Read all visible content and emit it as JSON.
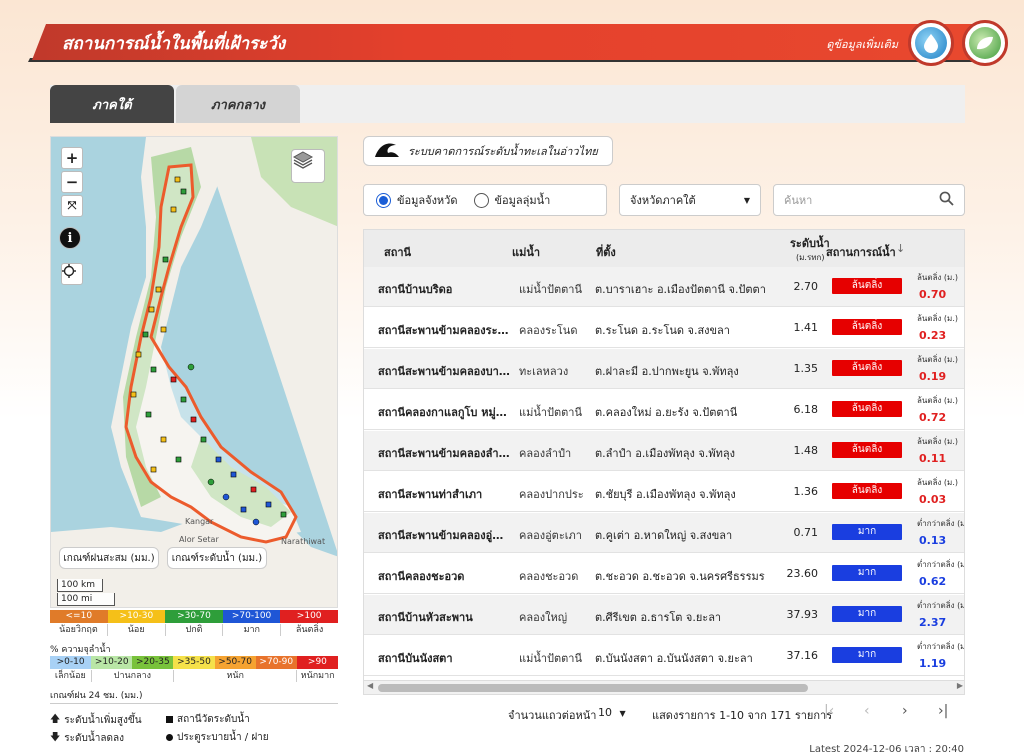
{
  "header": {
    "title": "สถานการณ์น้ำในพื้นที่เฝ้าระวัง",
    "more_link": "ดูข้อมูลเพิ่มเติม",
    "logo1_icon": "water-drop-logo",
    "logo2_icon": "leaf-logo"
  },
  "tabs": [
    {
      "label": "ภาคใต้",
      "active": true
    },
    {
      "label": "ภาคกลาง",
      "active": false
    }
  ],
  "map": {
    "zoom_in": "+",
    "zoom_out": "−",
    "rain_button": "เกณฑ์ฝนสะสม (มม.)",
    "level_button": "เกณฑ์ระดับน้ำ (มม.)",
    "scale_km": "100 km",
    "scale_mi": "100 mi",
    "places": [
      "Kangar",
      "Alor Setar",
      "Narathiwat"
    ]
  },
  "legend_level": {
    "ranges": [
      {
        "label": "<=10",
        "color": "#e07b29"
      },
      {
        "label": ">10-30",
        "color": "#f5c018"
      },
      {
        "label": ">30-70",
        "color": "#2e9e3a"
      },
      {
        "label": ">70-100",
        "color": "#1f56d6"
      },
      {
        "label": ">100",
        "color": "#e02020"
      }
    ],
    "labels": [
      "น้อยวิกฤต",
      "น้อย",
      "ปกติ",
      "มาก",
      "ล้นตลิ่ง"
    ]
  },
  "legend_capacity": {
    "title": "% ความจุลำน้ำ",
    "ranges": [
      {
        "label": ">0-10",
        "color": "#a8d1f5"
      },
      {
        "label": ">10-20",
        "color": "#b9e6a6"
      },
      {
        "label": ">20-35",
        "color": "#79c23b"
      },
      {
        "label": ">35-50",
        "color": "#f5e14a"
      },
      {
        "label": ">50-70",
        "color": "#f5a331"
      },
      {
        "label": ">70-90",
        "color": "#e8732c"
      },
      {
        "label": ">90",
        "color": "#e02020"
      }
    ],
    "labels": [
      "เล็กน้อย",
      "ปานกลาง",
      "หนัก",
      "หนักมาก"
    ]
  },
  "rain_note": "เกณฑ์ฝน 24 ชม. (มม.)",
  "symbols": {
    "rise": "ระดับน้ำเพิ่มสูงขึ้น",
    "fall": "ระดับน้ำลดลง",
    "station": "สถานีวัดระดับน้ำ",
    "gate": "ประตูระบายน้ำ / ฝาย"
  },
  "forecast_button": "ระบบคาดการณ์ระดับน้ำทะเลในอ่าวไทย",
  "filters": {
    "radio_province": "ข้อมูลจังหวัด",
    "radio_basin": "ข้อมูลลุ่มน้ำ",
    "province_select": "จังหวัดภาคใต้",
    "search_placeholder": "ค้นหา"
  },
  "table": {
    "headers": {
      "station": "สถานี",
      "river": "แม่น้ำ",
      "location": "ที่ตั้ง",
      "level": "ระดับน้ำ",
      "level_unit": "(ม.รทก)",
      "status": "สถานการณ์น้ำ"
    },
    "rows": [
      {
        "name": "สถานีบ้านบริดอ",
        "river": "แม่น้ำปัตตานี",
        "location": "ต.บาราเฮาะ อ.เมืองปัตตานี จ.ปัตตานี",
        "level": "2.70",
        "status": "ล้นตลิ่ง",
        "status_color": "#e60000",
        "diff_label": "ล้นตลิ่ง (ม.)",
        "diff": "0.70",
        "diff_color": "#e02020"
      },
      {
        "name": "สถานีสะพานข้ามคลองระโนด...",
        "river": "คลองระโนด",
        "location": "ต.ระโนด อ.ระโนด จ.สงขลา",
        "level": "1.41",
        "status": "ล้นตลิ่ง",
        "status_color": "#e60000",
        "diff_label": "ล้นตลิ่ง (ม.)",
        "diff": "0.23",
        "diff_color": "#e02020"
      },
      {
        "name": "สถานีสะพานข้ามคลองบางม่ว...",
        "river": "ทะเลหลวง",
        "location": "ต.ฝาละมี อ.ปากพะยูน จ.พัทลุง",
        "level": "1.35",
        "status": "ล้นตลิ่ง",
        "status_color": "#e60000",
        "diff_label": "ล้นตลิ่ง (ม.)",
        "diff": "0.19",
        "diff_color": "#e02020"
      },
      {
        "name": "สถานีคลองกาแลกูโบ หมู่ที่...",
        "river": "แม่น้ำปัตตานี",
        "location": "ต.คลองใหม่ อ.ยะรัง จ.ปัตตานี",
        "level": "6.18",
        "status": "ล้นตลิ่ง",
        "status_color": "#e60000",
        "diff_label": "ล้นตลิ่ง (ม.)",
        "diff": "0.72",
        "diff_color": "#e02020"
      },
      {
        "name": "สถานีสะพานข้ามคลองลำปำ",
        "river": "คลองลำปำ",
        "location": "ต.ลำปำ อ.เมืองพัทลุง จ.พัทลุง",
        "level": "1.48",
        "status": "ล้นตลิ่ง",
        "status_color": "#e60000",
        "diff_label": "ล้นตลิ่ง (ม.)",
        "diff": "0.11",
        "diff_color": "#e02020"
      },
      {
        "name": "สถานีสะพานท่าสำเภา",
        "river": "คลองปากประ",
        "location": "ต.ชัยบุรี อ.เมืองพัทลุง จ.พัทลุง",
        "level": "1.36",
        "status": "ล้นตลิ่ง",
        "status_color": "#e60000",
        "diff_label": "ล้นตลิ่ง (ม.)",
        "diff": "0.03",
        "diff_color": "#e02020"
      },
      {
        "name": "สถานีสะพานข้ามคลองอู่ตะเ...",
        "river": "คลองอู่ตะเภา",
        "location": "ต.คูเต่า อ.หาดใหญ่ จ.สงขลา",
        "level": "0.71",
        "status": "มาก",
        "status_color": "#1a3ee0",
        "diff_label": "ต่ำกว่าตลิ่ง (ม.)",
        "diff": "0.13",
        "diff_color": "#1a3ee0"
      },
      {
        "name": "สถานีคลองชะอวด",
        "river": "คลองชะอวด",
        "location": "ต.ชะอวด อ.ชะอวด จ.นครศรีธรรมราช",
        "level": "23.60",
        "status": "มาก",
        "status_color": "#1a3ee0",
        "diff_label": "ต่ำกว่าตลิ่ง (ม.)",
        "diff": "0.62",
        "diff_color": "#1a3ee0"
      },
      {
        "name": "สถานีบ้านหัวสะพาน",
        "river": "คลองใหญ่",
        "location": "ต.ศีรีเขต อ.ธารโต จ.ยะลา",
        "level": "37.93",
        "status": "มาก",
        "status_color": "#1a3ee0",
        "diff_label": "ต่ำกว่าตลิ่ง (ม.)",
        "diff": "2.37",
        "diff_color": "#1a3ee0"
      },
      {
        "name": "สถานีบันนังสตา",
        "river": "แม่น้ำปัตตานี",
        "location": "ต.บันนังสตา อ.บันนังสตา จ.ยะลา",
        "level": "37.16",
        "status": "มาก",
        "status_color": "#1a3ee0",
        "diff_label": "ต่ำกว่าตลิ่ง (ม.)",
        "diff": "1.19",
        "diff_color": "#1a3ee0"
      }
    ]
  },
  "pagination": {
    "rows_per_page_label": "จำนวนแถวต่อหน้า",
    "rows_per_page": "10",
    "range_text": "แสดงรายการ 1-10 จาก 171 รายการ"
  },
  "latest": "Latest 2024-12-06 เวลา : 20:40"
}
